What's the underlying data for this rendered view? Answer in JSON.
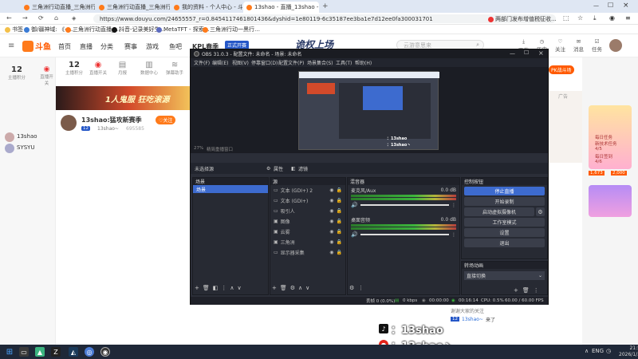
{
  "browser": {
    "tabs": [
      {
        "label": "三角洲行动直播_三角洲行动直…",
        "color": "#ff7a1a"
      },
      {
        "label": "三角洲行动直播_三角洲行动直…",
        "color": "#ff7a1a"
      },
      {
        "label": "我的资料 - 个人中心 - 斗鱼",
        "color": "#ff7a1a"
      },
      {
        "label": "13shao - 直播_13shao - 斗鱼",
        "color": "#ff7a1a"
      }
    ],
    "url": "https://www.douyu.com/24655557_r=0.8454117461801436&dyshid=1e80119-6c35187ee3ba1e7d12ee0fa300031701",
    "right_tab_label": "两部门发布增值税征收...",
    "bookmarks": [
      "书签",
      "御/疆神域: 《一…",
      "三角洲行动直播_…",
      "抖音-记录美好生…",
      "MetaTFT - 探索…",
      "三角洲行动一黑行…"
    ]
  },
  "nav": {
    "logo": "斗鱼",
    "links": [
      "首页",
      "直播",
      "分类",
      "赛事",
      "游戏",
      "鱼吧"
    ],
    "event_label": "KPL春季",
    "event_sub": "正式开赛",
    "banner": "诡权上场",
    "search_placeholder": "云游意思来",
    "right_buttons": [
      "下载",
      "历史",
      "关注",
      "消息",
      "任务"
    ]
  },
  "sidebar": {
    "stats": [
      {
        "value": "12",
        "label": "主播积分"
      },
      {
        "value": "",
        "label": "直播开关"
      },
      {
        "value": "",
        "label": "月报"
      },
      {
        "value": "",
        "label": "数据中心"
      },
      {
        "value": "",
        "label": "弹幕助手"
      }
    ],
    "users": [
      "13shao",
      "SYSYU"
    ]
  },
  "stream": {
    "title": "13shao:猛攻新赛季",
    "follow_label": "关注",
    "room_label": "695585",
    "level_label": "12",
    "anchor_name": "13shao~",
    "chat": [
      {
        "user": "",
        "text": "谢谢大家的关注"
      },
      {
        "user": "13shao~",
        "text": "来了"
      }
    ],
    "banner_text": "1人鬼服 狂吃滚源",
    "ad_label": "广告",
    "pk_label": "PK战斗场",
    "rank_labels": [
      "1,673",
      "2,000"
    ],
    "reward_labels": [
      "每日任务",
      "新技术任务",
      "4/5",
      "每日签到",
      "4/6"
    ]
  },
  "obs": {
    "title": "OBS 31.0.3 - 配置文件: 未命名 - 场景: 未命名",
    "menu": [
      "文件(F)",
      "编辑(E)",
      "视图(V)",
      "停靠窗口(D)",
      "配置文件(P)",
      "场景集合(S)",
      "工具(T)",
      "帮助(H)"
    ],
    "status_bar_zoom": "27%",
    "status_bar_hint": "精简重播窗口",
    "no_source": "未选择源",
    "properties_label": "属性",
    "filters_label": "滤镜",
    "scenes_title": "场景",
    "scenes": [
      "场景"
    ],
    "sources_title": "源",
    "sources": [
      "文本 (GDI+) 2",
      "文本 (GDI+)",
      "吸引人",
      "图像",
      "云雾",
      "三角洲",
      "显示器采集"
    ],
    "mixer_title": "混音器",
    "mixer": [
      {
        "name": "麦克风/Aux",
        "db": "0.0 dB"
      },
      {
        "name": "桌面音频",
        "db": "0.0 dB"
      }
    ],
    "controls_title": "控制按钮",
    "controls": [
      "停止直播",
      "开始录制",
      "启动虚拟摄像机",
      "工作室模式",
      "设置",
      "退出"
    ],
    "transition_title": "转场动画",
    "transition_value": "直接切换",
    "status": {
      "dropped": "丢帧 0 (0.0%)",
      "bitrate": "0 kbps",
      "rec_time": "00:00:00",
      "live_time": "00:16:14",
      "cpu": "CPU: 0.5%",
      "fps": "60.00 / 60.00 FPS"
    }
  },
  "watermark": {
    "line1": "：13shao",
    "line2": "：13shao丶"
  },
  "taskbar": {
    "time": "21:51",
    "date": "2026/1/31",
    "lang": "ENG"
  },
  "colors": {
    "douyu_orange": "#ff7a1a",
    "obs_bg": "#2b2e38",
    "obs_accent": "#3d6bcf",
    "live_green": "#3cb43c",
    "taskbar": "#1f2838"
  }
}
